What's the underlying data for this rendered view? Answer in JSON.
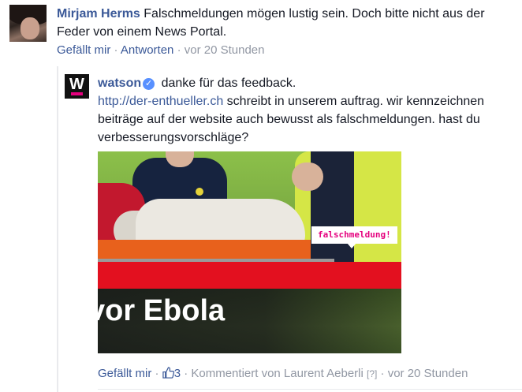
{
  "comment1": {
    "author": "Mirjam Herms",
    "line1": "Falschmeldungen mögen lustig sein. Doch bitte nicht aus der",
    "line2": "Feder von einem News Portal.",
    "like_label": "Gefällt mir",
    "sep1": " · ",
    "reply_label": "Antworten",
    "sep2": " · ",
    "time": "vor 20 Stunden"
  },
  "reply": {
    "author": "watson",
    "verified_icon": "verified-badge-icon",
    "first_line": "danke für das feedback.",
    "link": "http://der-enthueller.ch",
    "line2_rest": " schreibt in unserem auftrag. wir kennzeichnen",
    "line3": "beiträge auf der website auch bewusst als falschmeldungen. hast du",
    "line4": "verbesserungsvorschläge?",
    "image": {
      "headline": "vor Ebola",
      "tag": "falschmeldung!",
      "logo_letter": "W"
    },
    "like_label": "Gefällt mir",
    "sep1": " · ",
    "like_count": "3",
    "sep2": " · ",
    "commented_by": "Kommentiert von Laurent Aeberli",
    "help": "[?]",
    "sep3": " · ",
    "time": "vor 20 Stunden"
  },
  "colors": {
    "link": "#3b5998",
    "muted": "#9197a3",
    "watson_pink": "#e5007e",
    "banner_red": "#e3101f"
  }
}
